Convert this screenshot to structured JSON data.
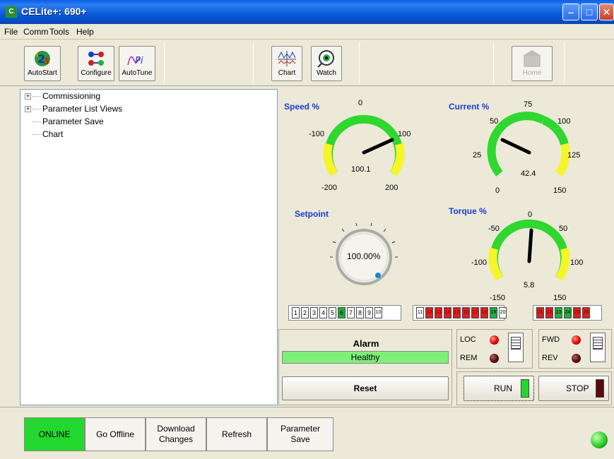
{
  "window": {
    "title": "CELite+: 690+"
  },
  "menu": [
    "File",
    "Comm",
    "Tools",
    "Help"
  ],
  "toolbar": {
    "autostart": "AutoStart",
    "configure": "Configure",
    "autotune": "AutoTune",
    "chart": "Chart",
    "watch": "Watch",
    "home": "Home"
  },
  "tree": {
    "items": [
      "Commissioning",
      "Parameter List Views",
      "Parameter Save",
      "Chart"
    ]
  },
  "gauges": {
    "speed": {
      "label": "Speed %",
      "value": "100.1",
      "ticks": [
        "0",
        "-100",
        "100",
        "-200",
        "200"
      ]
    },
    "current": {
      "label": "Current %",
      "value": "42.4",
      "ticks": [
        "75",
        "50",
        "100",
        "25",
        "125",
        "0",
        "150"
      ]
    },
    "setpoint": {
      "label": "Setpoint",
      "value": "100.00%"
    },
    "torque": {
      "label": "Torque %",
      "value": "5.8",
      "ticks": [
        "0",
        "-50",
        "50",
        "-100",
        "100",
        "-150",
        "150"
      ]
    }
  },
  "io": {
    "group1": [
      "1",
      "2",
      "3",
      "4",
      "5",
      "6",
      "7",
      "8",
      "9",
      "10"
    ],
    "group2": [
      "11",
      "12",
      "13",
      "14",
      "15",
      "16",
      "17",
      "18",
      "19",
      "20"
    ],
    "group3": [
      "21",
      "22",
      "23",
      "24",
      "25",
      "26"
    ]
  },
  "alarm": {
    "title": "Alarm",
    "status": "Healthy",
    "reset": "Reset"
  },
  "control": {
    "loc": "LOC",
    "rem": "REM",
    "fwd": "FWD",
    "rev": "REV",
    "run": "RUN",
    "stop": "STOP"
  },
  "bottom": {
    "online": "ONLINE",
    "go_offline": "Go Offline",
    "download": "Download Changes",
    "refresh": "Refresh",
    "param_save": "Parameter Save"
  }
}
